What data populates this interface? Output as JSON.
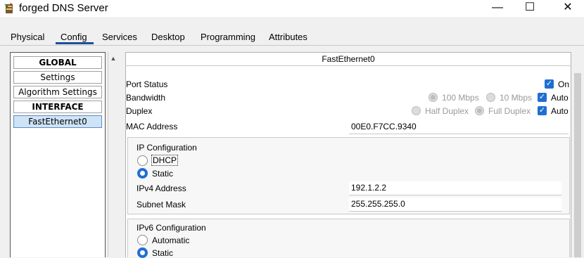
{
  "window": {
    "title": "forged DNS Server",
    "icon": "server-icon",
    "controls": {
      "minimize": "—",
      "maximize": "☐",
      "close": "✕"
    }
  },
  "tabs": [
    {
      "label": "Physical",
      "active": false
    },
    {
      "label": "Config",
      "active": true
    },
    {
      "label": "Services",
      "active": false
    },
    {
      "label": "Desktop",
      "active": false
    },
    {
      "label": "Programming",
      "active": false
    },
    {
      "label": "Attributes",
      "active": false
    }
  ],
  "sidebar": {
    "items": [
      {
        "label": "GLOBAL",
        "bold": true
      },
      {
        "label": "Settings",
        "bold": false
      },
      {
        "label": "Algorithm Settings",
        "bold": false
      },
      {
        "label": "INTERFACE",
        "bold": true
      },
      {
        "label": "FastEthernet0",
        "bold": false,
        "selected": true
      }
    ]
  },
  "panel": {
    "header": "FastEthernet0",
    "port_status": {
      "label": "Port Status",
      "on_label": "On",
      "on_checked": true
    },
    "bandwidth": {
      "label": "Bandwidth",
      "opt1": "100 Mbps",
      "opt2": "10 Mbps",
      "auto_label": "Auto",
      "auto_checked": true
    },
    "duplex": {
      "label": "Duplex",
      "opt1": "Half Duplex",
      "opt2": "Full Duplex",
      "auto_label": "Auto",
      "auto_checked": true
    },
    "mac": {
      "label": "MAC Address",
      "value": "00E0.F7CC.9340"
    },
    "ip_config": {
      "title": "IP Configuration",
      "dhcp_label": "DHCP",
      "static_label": "Static",
      "mode": "Static",
      "ipv4_label": "IPv4 Address",
      "ipv4_value": "192.1.2.2",
      "mask_label": "Subnet Mask",
      "mask_value": "255.255.255.0"
    },
    "ipv6_config": {
      "title": "IPv6 Configuration",
      "automatic_label": "Automatic",
      "static_label": "Static",
      "mode": "Static"
    }
  },
  "colors": {
    "accent": "#1f6fd1",
    "selected_bg": "#cfe3f6",
    "tab_underline": "#1a4f9a"
  }
}
